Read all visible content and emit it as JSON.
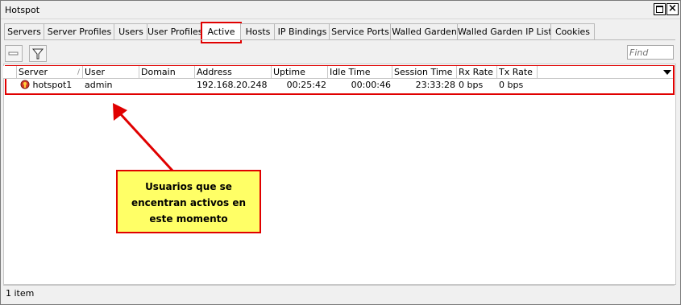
{
  "window": {
    "title": "Hotspot"
  },
  "tabs": [
    {
      "label": "Servers"
    },
    {
      "label": "Server Profiles"
    },
    {
      "label": "Users"
    },
    {
      "label": "User Profiles"
    },
    {
      "label": "Active"
    },
    {
      "label": "Hosts"
    },
    {
      "label": "IP Bindings"
    },
    {
      "label": "Service Ports"
    },
    {
      "label": "Walled Garden"
    },
    {
      "label": "Walled Garden IP List"
    },
    {
      "label": "Cookies"
    }
  ],
  "active_tab": "Active",
  "toolbar": {
    "find_placeholder": "Find",
    "remove_icon": "minus-icon",
    "filter_icon": "filter-icon"
  },
  "table": {
    "columns": [
      "Server",
      "User",
      "Domain",
      "Address",
      "Uptime",
      "Idle Time",
      "Session Time ...",
      "Rx Rate",
      "Tx Rate"
    ],
    "rows": [
      {
        "server": "hotspot1",
        "user": "admin",
        "domain": "",
        "address": "192.168.20.248",
        "uptime": "00:25:42",
        "idle_time": "00:00:46",
        "session_time": "23:33:28",
        "rx_rate": "0 bps",
        "tx_rate": "0 bps"
      }
    ]
  },
  "status": {
    "count": "1 item"
  },
  "annotation": {
    "lines": [
      "Usuarios que se",
      "encentran activos en",
      "este momento"
    ],
    "colors": {
      "fill": "#ffff66",
      "border": "#e00000",
      "arrow": "#e00000"
    }
  }
}
